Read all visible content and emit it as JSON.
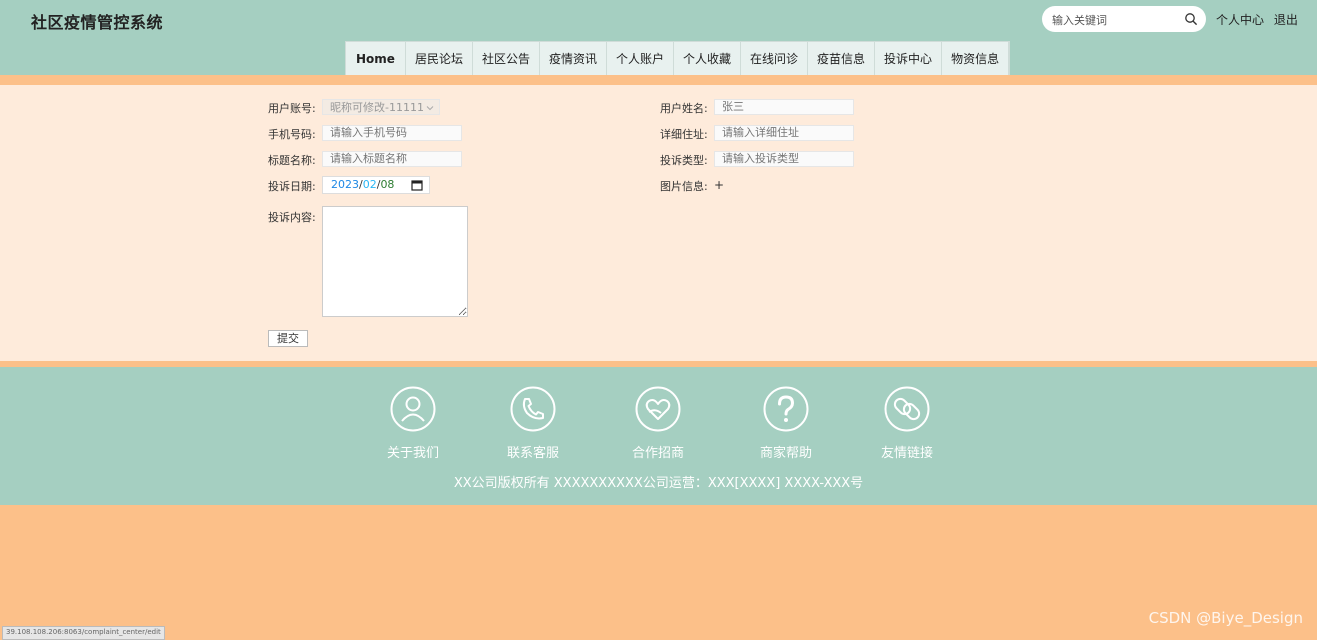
{
  "header": {
    "title": "社区疫情管控系统",
    "search_placeholder": "输入关键词",
    "links": [
      "个人中心",
      "退出"
    ]
  },
  "nav": [
    "Home",
    "居民论坛",
    "社区公告",
    "疫情资讯",
    "个人账户",
    "个人收藏",
    "在线问诊",
    "疫苗信息",
    "投诉中心",
    "物资信息"
  ],
  "form": {
    "account_label": "用户账号:",
    "account_value": "昵称可修改-11111",
    "name_label": "用户姓名:",
    "name_placeholder": "张三",
    "phone_label": "手机号码:",
    "phone_placeholder": "请输入手机号码",
    "address_label": "详细住址:",
    "address_placeholder": "请输入详细住址",
    "title_label": "标题名称:",
    "title_placeholder": "请输入标题名称",
    "type_label": "投诉类型:",
    "type_placeholder": "请输入投诉类型",
    "date_label": "投诉日期:",
    "date_year": "2023",
    "date_month": "02",
    "date_day": "08",
    "image_label": "图片信息:",
    "image_add": "+",
    "content_label": "投诉内容:",
    "submit": "提交"
  },
  "footer": {
    "items": [
      {
        "label": "关于我们",
        "icon": "user-icon"
      },
      {
        "label": "联系客服",
        "icon": "phone-icon"
      },
      {
        "label": "合作招商",
        "icon": "heart-icon"
      },
      {
        "label": "商家帮助",
        "icon": "question-icon"
      },
      {
        "label": "友情链接",
        "icon": "link-icon"
      }
    ],
    "copyright": "XX公司版权所有 XXXXXXXXXX公司运营：XXX[XXXX] XXXX-XXX号"
  },
  "status_url": "39.108.108.206:8063/complaint_center/edit",
  "watermark": "CSDN @Biye_Design",
  "colors": {
    "header": "#a5cfc1",
    "form_bg": "#feebdb",
    "accent": "#fcc089"
  }
}
